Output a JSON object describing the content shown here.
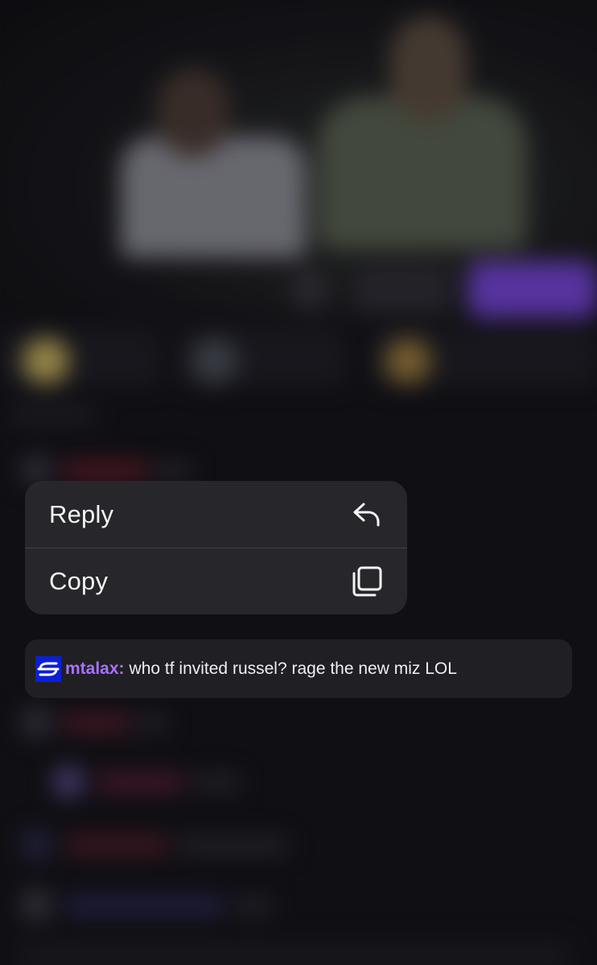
{
  "context_menu": {
    "items": [
      {
        "label": "Reply",
        "icon": "reply-arrow-icon"
      },
      {
        "label": "Copy",
        "icon": "copy-icon"
      }
    ]
  },
  "chat_message": {
    "badge_icon": "channel-subscriber-badge-icon",
    "username": "mtalax",
    "separator": ":",
    "text": "who tf invited russel? rage the new miz LOL",
    "username_color": "#a970ff",
    "badge_color": "#0b20d6"
  },
  "colors": {
    "menu_background": "#28282c",
    "message_background": "#1f1f24",
    "accent_purple": "#7443d6"
  }
}
